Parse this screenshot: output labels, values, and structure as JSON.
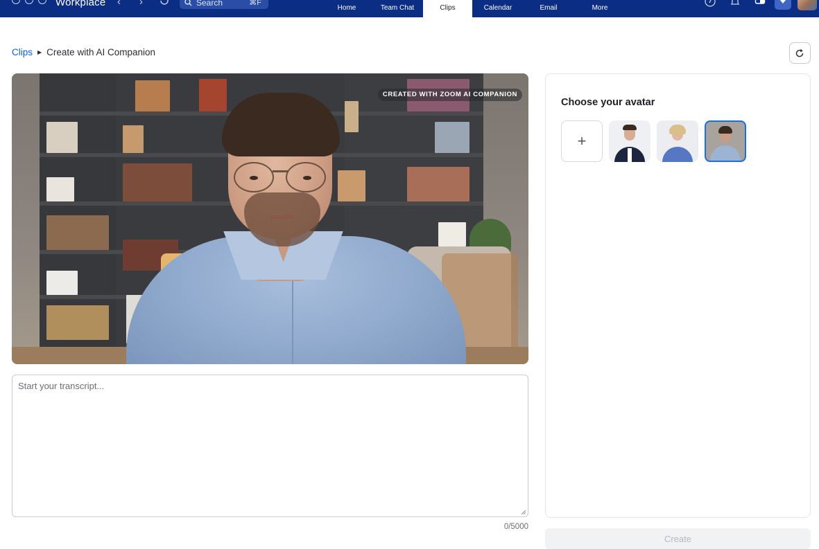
{
  "app": {
    "title": "Workplace"
  },
  "topbar": {
    "search_placeholder": "Search",
    "search_shortcut": "⌘F",
    "tabs": [
      {
        "label": "Home",
        "active": false
      },
      {
        "label": "Team Chat",
        "active": false
      },
      {
        "label": "Clips",
        "active": true
      },
      {
        "label": "Calendar",
        "active": false
      },
      {
        "label": "Email",
        "active": false
      },
      {
        "label": "More",
        "active": false
      }
    ],
    "icons": [
      "help-icon",
      "bell-icon",
      "panel-icon",
      "premium-icon",
      "user-avatar"
    ]
  },
  "breadcrumb": {
    "parent": "Clips",
    "current": "Create with AI Companion"
  },
  "video": {
    "badge": "CREATED WITH ZOOM AI COMPANION"
  },
  "transcript": {
    "placeholder": "Start your transcript...",
    "value": "",
    "count": "0/5000"
  },
  "avatar_panel": {
    "title": "Choose your avatar",
    "avatars": [
      {
        "name": "avatar-add",
        "selected": false
      },
      {
        "name": "avatar-man-suit",
        "selected": false
      },
      {
        "name": "avatar-woman-blonde",
        "selected": false
      },
      {
        "name": "avatar-man-glasses",
        "selected": true
      }
    ]
  },
  "actions": {
    "create_label": "Create",
    "create_disabled": true
  },
  "colors": {
    "topbar": "#0b2d83",
    "accent": "#0e72ed",
    "link": "#0e5fd8"
  }
}
